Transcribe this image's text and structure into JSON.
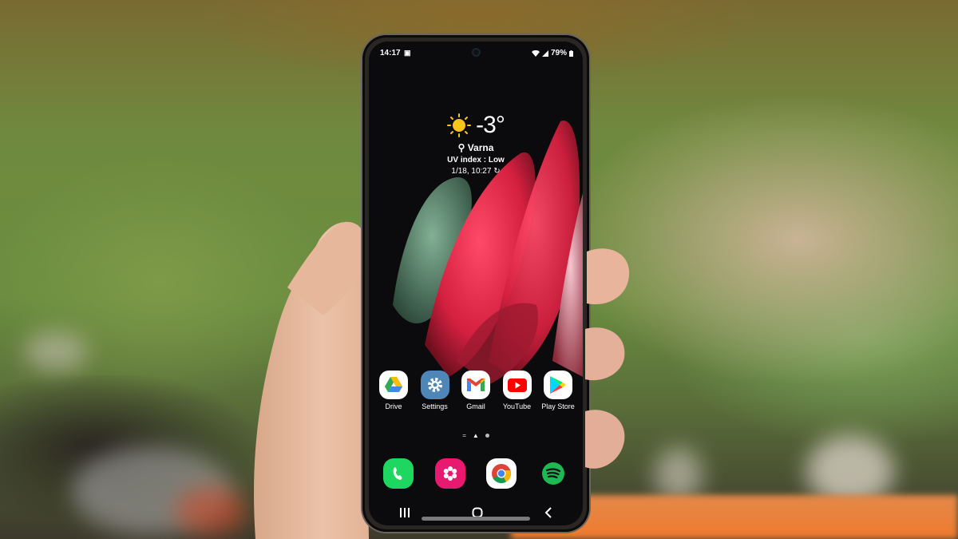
{
  "scene": {
    "description": "Hand holding a Samsung Galaxy phone showing the home screen against a blurred outdoor background",
    "colors": {
      "accent_orange": "#f07a2c",
      "foliage": "#6b8d3f"
    }
  },
  "status_bar": {
    "time": "14:17",
    "notification_icon": "gallery-icon",
    "wifi_icon": "wifi-icon",
    "signal_icon": "signal-icon",
    "battery": "79%",
    "battery_icon": "battery-icon"
  },
  "weather_widget": {
    "icon": "sun-icon",
    "temperature": "-3°",
    "location_icon": "location-pin-icon",
    "location": "Varna",
    "uv_index": "UV index : Low",
    "updated": "1/18, 10:27",
    "refresh_icon": "refresh-icon"
  },
  "apps": [
    {
      "label": "Drive",
      "icon": "google-drive-icon",
      "bg": "#ffffff"
    },
    {
      "label": "Settings",
      "icon": "gear-icon",
      "bg": "#4f86b8"
    },
    {
      "label": "Gmail",
      "icon": "gmail-icon",
      "bg": "#ffffff"
    },
    {
      "label": "YouTube",
      "icon": "youtube-icon",
      "bg": "#ffffff"
    },
    {
      "label": "Play Store",
      "icon": "play-store-icon",
      "bg": "#ffffff"
    }
  ],
  "page_indicator": {
    "pages": 3,
    "current": 2
  },
  "dock": [
    {
      "name": "phone",
      "icon": "phone-icon",
      "bg": "#1ed760"
    },
    {
      "name": "gallery",
      "icon": "flower-icon",
      "bg": "#ea1970"
    },
    {
      "name": "chrome",
      "icon": "chrome-icon",
      "bg": "#ffffff"
    },
    {
      "name": "spotify",
      "icon": "spotify-icon",
      "bg": "#1db954"
    }
  ],
  "nav_bar": {
    "recents": "recents-icon",
    "home": "home-icon",
    "back": "back-icon"
  }
}
